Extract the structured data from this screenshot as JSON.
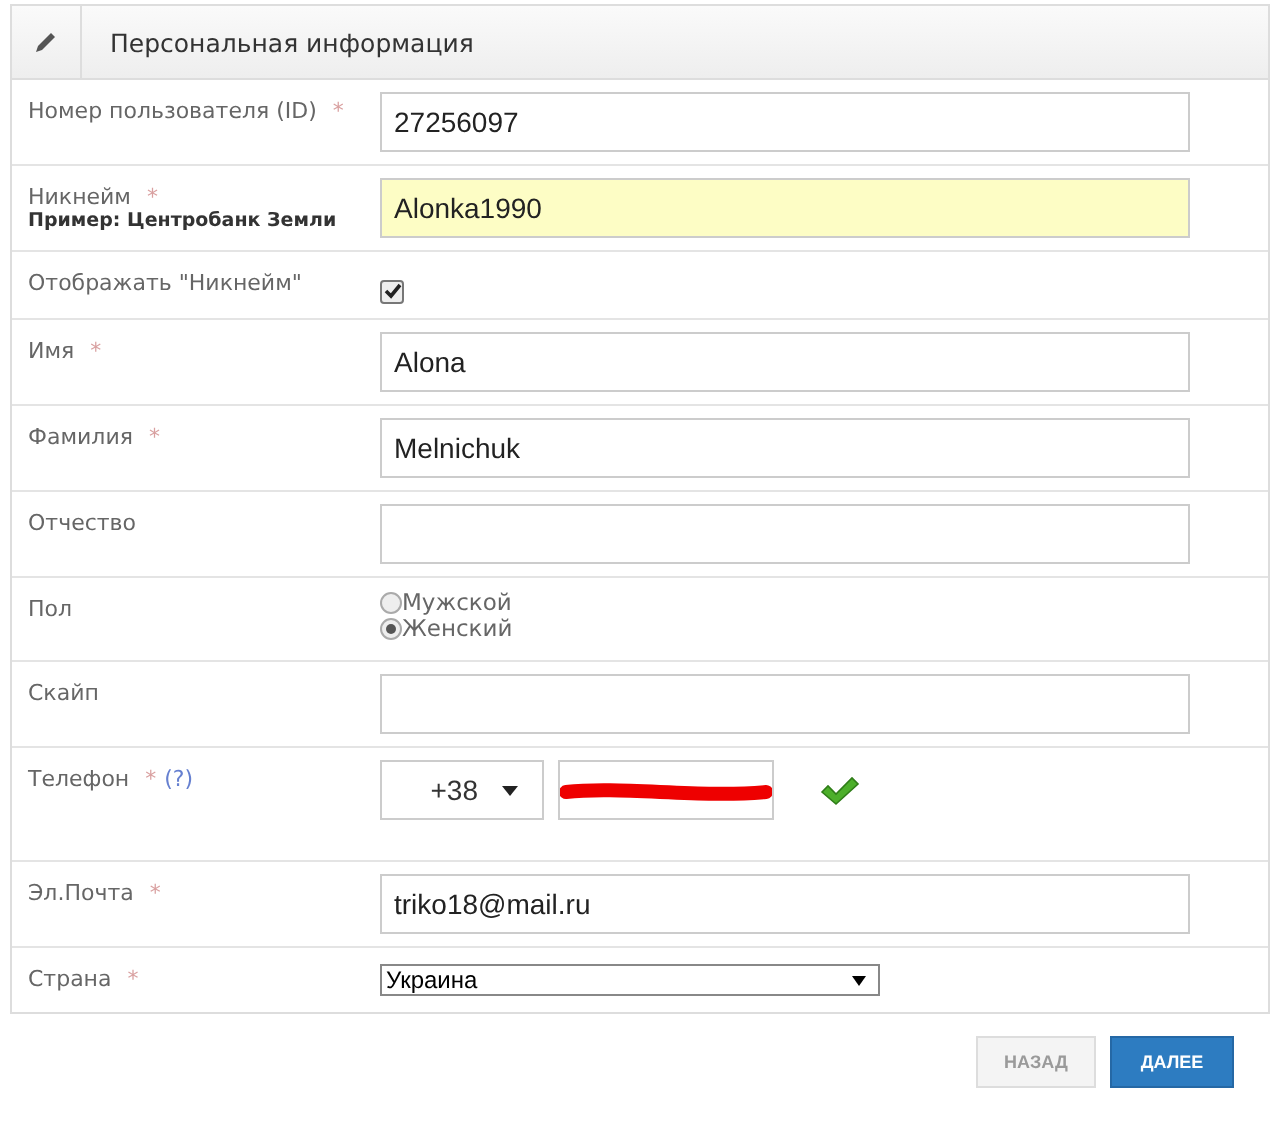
{
  "panel": {
    "title": "Персональная информация"
  },
  "fields": [
    {
      "kind": "text",
      "label": "Номер пользователя (ID)",
      "required": "*",
      "value": "27256097",
      "highlighted": false
    },
    {
      "kind": "text",
      "label": "Никнейм",
      "required": "*",
      "hint": "Пример: Центробанк Земли",
      "value": "Alonka1990",
      "highlighted": true
    },
    {
      "kind": "checkbox",
      "label": "Отображать \"Никнейм\"",
      "checked": true
    },
    {
      "kind": "text",
      "label": "Имя",
      "required": "*",
      "value": "Alona",
      "highlighted": false
    },
    {
      "kind": "text",
      "label": "Фамилия",
      "required": "*",
      "value": "Melnichuk",
      "highlighted": false
    },
    {
      "kind": "text",
      "label": "Отчество",
      "highlighted": false
    },
    {
      "kind": "radio",
      "label": "Пол",
      "options": [
        {
          "label": "Мужской",
          "selected": false
        },
        {
          "label": "Женский",
          "selected": true
        }
      ]
    },
    {
      "kind": "text",
      "label": "Скайп",
      "highlighted": false
    },
    {
      "kind": "phone",
      "label": "Телефон",
      "required": "*",
      "help": "(?)",
      "code": "+38",
      "valid": true
    },
    {
      "kind": "text",
      "label": "Эл.Почта",
      "required": "*",
      "value": "triko18@mail.ru",
      "highlighted": false
    },
    {
      "kind": "select",
      "label": "Страна",
      "required": "*",
      "value": "Украина"
    }
  ],
  "buttons": [
    {
      "label": "НАЗАД",
      "disabled": true
    },
    {
      "label": "ДАЛЕЕ",
      "disabled": false
    }
  ]
}
